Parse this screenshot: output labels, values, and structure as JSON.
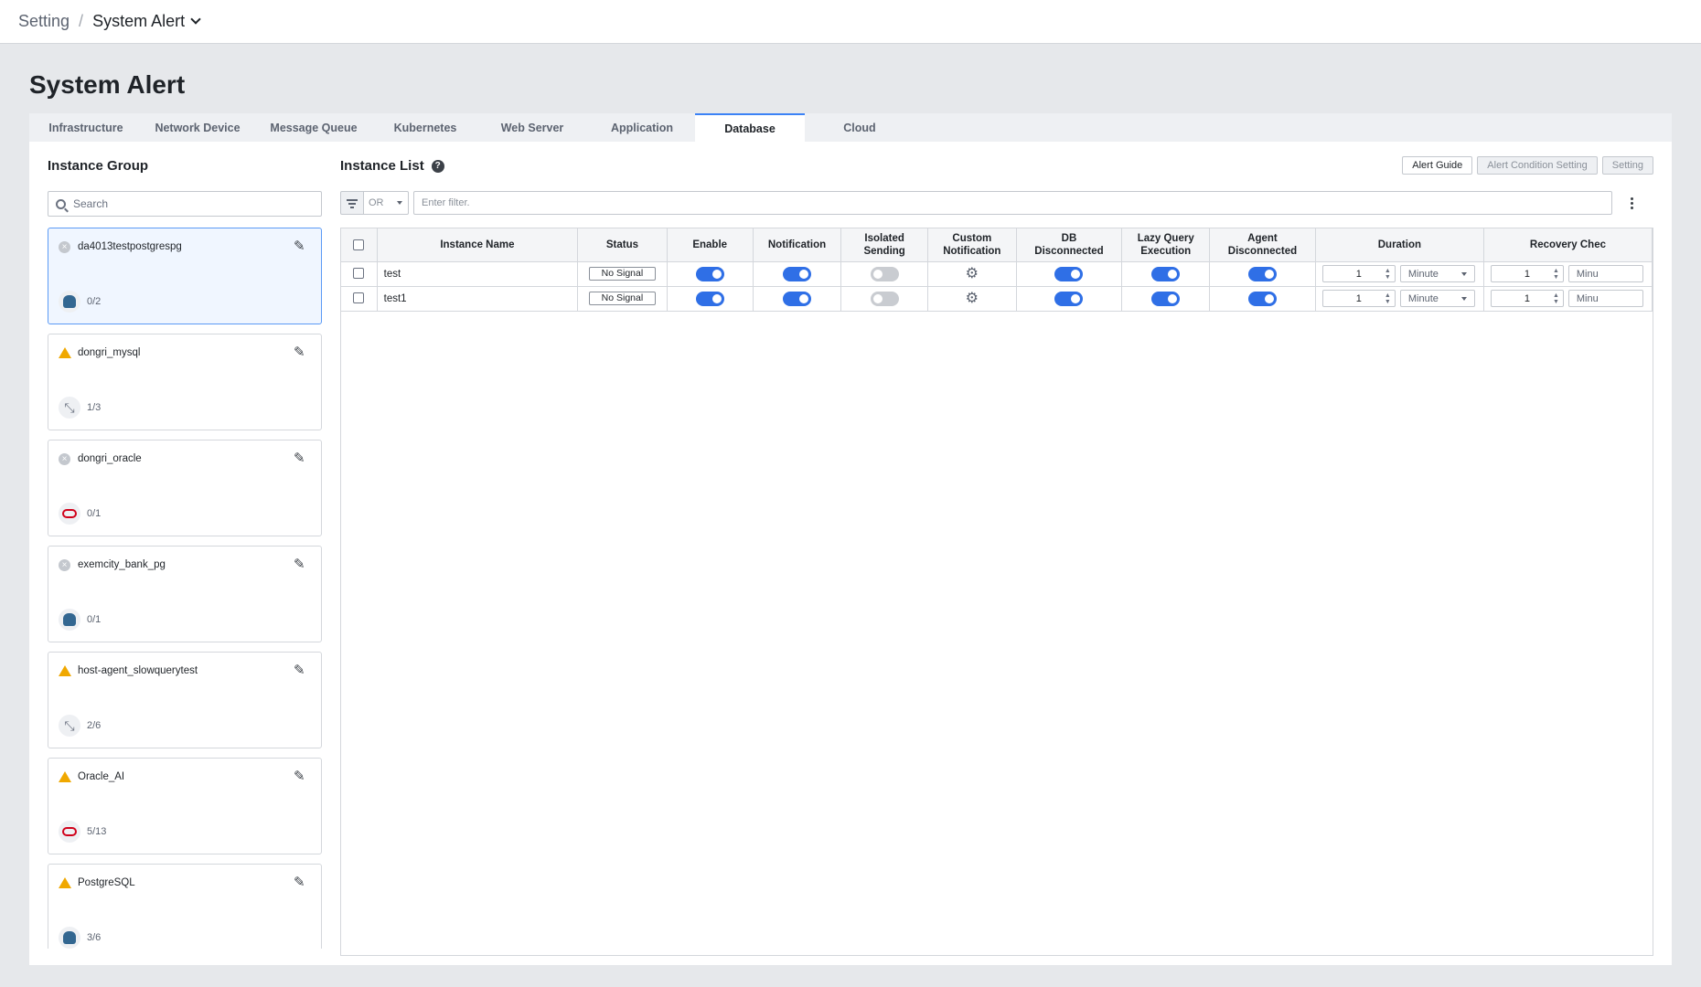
{
  "breadcrumb": {
    "parent": "Setting",
    "separator": "/",
    "current": "System Alert"
  },
  "page_title": "System Alert",
  "tabs": [
    {
      "label": "Infrastructure",
      "active": false
    },
    {
      "label": "Network Device",
      "active": false
    },
    {
      "label": "Message Queue",
      "active": false
    },
    {
      "label": "Kubernetes",
      "active": false
    },
    {
      "label": "Web Server",
      "active": false
    },
    {
      "label": "Application",
      "active": false
    },
    {
      "label": "Database",
      "active": true
    },
    {
      "label": "Cloud",
      "active": false
    }
  ],
  "instance_group": {
    "title": "Instance Group",
    "search_placeholder": "Search",
    "groups": [
      {
        "name": "da4013testpostgrespg",
        "status": "inactive",
        "db_icon": "postgresql-icon",
        "count": "0/2",
        "selected": true
      },
      {
        "name": "dongri_mysql",
        "status": "warning",
        "db_icon": "mysql-icon",
        "count": "1/3",
        "selected": false
      },
      {
        "name": "dongri_oracle",
        "status": "inactive",
        "db_icon": "oracle-icon",
        "count": "0/1",
        "selected": false
      },
      {
        "name": "exemcity_bank_pg",
        "status": "inactive",
        "db_icon": "postgresql-icon",
        "count": "0/1",
        "selected": false
      },
      {
        "name": "host-agent_slowquerytest",
        "status": "warning",
        "db_icon": "mysql-icon",
        "count": "2/6",
        "selected": false
      },
      {
        "name": "Oracle_AI",
        "status": "warning",
        "db_icon": "oracle-icon",
        "count": "5/13",
        "selected": false
      },
      {
        "name": "PostgreSQL",
        "status": "warning",
        "db_icon": "postgresql-icon",
        "count": "3/6",
        "selected": false
      }
    ]
  },
  "instance_list": {
    "title": "Instance List",
    "buttons": {
      "alert_guide": "Alert Guide",
      "alert_condition_setting": "Alert Condition Setting",
      "setting": "Setting"
    },
    "filter": {
      "operator": "OR",
      "placeholder": "Enter filter."
    },
    "columns": {
      "instance_name": "Instance Name",
      "status": "Status",
      "enable": "Enable",
      "notification": "Notification",
      "isolated_sending_1": "Isolated",
      "isolated_sending_2": "Sending",
      "custom_notification_1": "Custom",
      "custom_notification_2": "Notification",
      "db_disconnected_1": "DB",
      "db_disconnected_2": "Disconnected",
      "lazy_query_1": "Lazy Query",
      "lazy_query_2": "Execution",
      "agent_disconnected_1": "Agent",
      "agent_disconnected_2": "Disconnected",
      "duration": "Duration",
      "recovery_check": "Recovery Chec"
    },
    "rows": [
      {
        "name": "test",
        "status": "No Signal",
        "enable": true,
        "notification": true,
        "isolated_sending": false,
        "db_disconnected": true,
        "lazy_query": true,
        "agent_disconnected": true,
        "duration_value": "1",
        "duration_unit": "Minute",
        "recovery_value": "1",
        "recovery_unit": "Minu"
      },
      {
        "name": "test1",
        "status": "No Signal",
        "enable": true,
        "notification": true,
        "isolated_sending": false,
        "db_disconnected": true,
        "lazy_query": true,
        "agent_disconnected": true,
        "duration_value": "1",
        "duration_unit": "Minute",
        "recovery_value": "1",
        "recovery_unit": "Minu"
      }
    ]
  },
  "colors": {
    "accent": "#2f6fe6",
    "warning": "#f0a800",
    "oracle": "#d0021b",
    "postgres": "#336791"
  }
}
